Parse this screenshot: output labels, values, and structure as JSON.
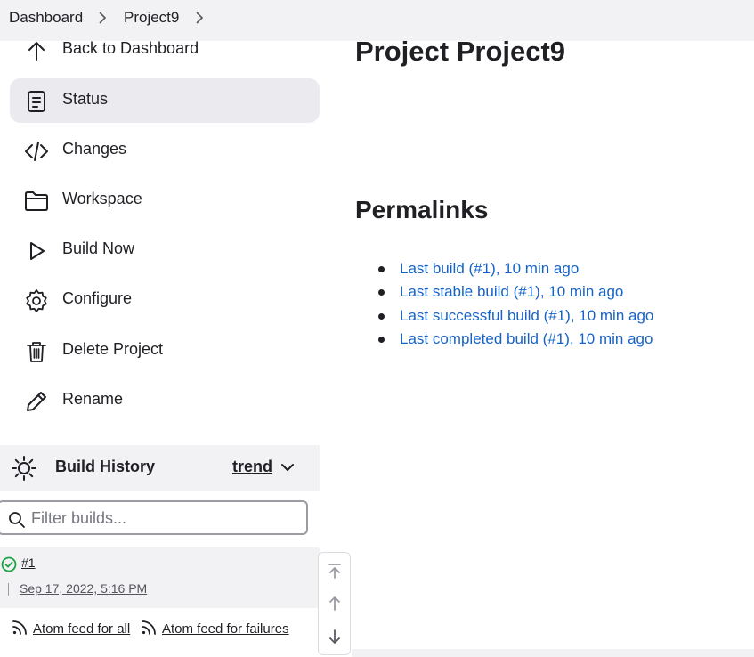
{
  "breadcrumb": {
    "items": [
      {
        "label": "Dashboard"
      },
      {
        "label": "Project9"
      }
    ]
  },
  "sidebar": {
    "items": [
      {
        "label": "Back to Dashboard",
        "icon": "arrow-up-icon"
      },
      {
        "label": "Status",
        "icon": "document-icon",
        "active": true
      },
      {
        "label": "Changes",
        "icon": "code-icon"
      },
      {
        "label": "Workspace",
        "icon": "folder-icon"
      },
      {
        "label": "Build Now",
        "icon": "play-icon"
      },
      {
        "label": "Configure",
        "icon": "gear-icon"
      },
      {
        "label": "Delete Project",
        "icon": "trash-icon"
      },
      {
        "label": "Rename",
        "icon": "pencil-icon"
      }
    ]
  },
  "build_history": {
    "title": "Build History",
    "trend_label": "trend",
    "filter_placeholder": "Filter builds...",
    "filter_value": "",
    "builds": [
      {
        "number": "#1",
        "date": "Sep 17, 2022, 5:16 PM",
        "status": "success"
      }
    ],
    "feeds": {
      "all_label": "Atom feed for all",
      "failures_label": "Atom feed for failures"
    }
  },
  "main": {
    "title": "Project Project9",
    "permalinks_title": "Permalinks",
    "permalinks": [
      "Last build (#1), 10 min ago",
      "Last stable build (#1), 10 min ago",
      "Last successful build (#1), 10 min ago",
      "Last completed build (#1), 10 min ago"
    ]
  },
  "colors": {
    "link": "#1663c7",
    "success": "#1ea446",
    "header_bg": "#f2f2f4",
    "active_bg": "#ebebef"
  }
}
